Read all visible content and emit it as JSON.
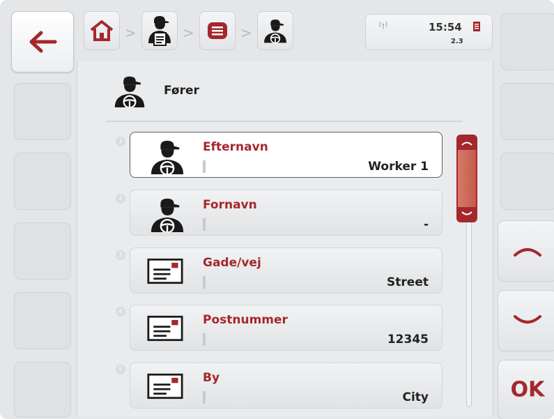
{
  "header": {
    "breadcrumbs": [
      {
        "icon": "home-icon"
      },
      {
        "icon": "driver-document-icon"
      },
      {
        "icon": "list-icon"
      },
      {
        "icon": "driver-icon"
      }
    ],
    "separator": ">"
  },
  "status": {
    "time": "15:54",
    "version": "2.3",
    "signal_icon": "signal-icon",
    "document_icon": "document-icon"
  },
  "left_nav": {
    "back_icon": "back-arrow-icon"
  },
  "right_nav": {
    "up_icon": "chevron-up-icon",
    "down_icon": "chevron-down-icon",
    "ok_label": "OK"
  },
  "page": {
    "title": "Fører",
    "title_icon": "driver-icon"
  },
  "items": [
    {
      "number": "1",
      "icon": "driver-icon",
      "label": "Efternavn",
      "value": "Worker 1",
      "selected": true
    },
    {
      "number": "2",
      "icon": "driver-icon",
      "label": "Fornavn",
      "value": "-",
      "selected": false
    },
    {
      "number": "3",
      "icon": "address-card-icon",
      "label": "Gade/vej",
      "value": "Street",
      "selected": false
    },
    {
      "number": "4",
      "icon": "address-card-icon",
      "label": "Postnummer",
      "value": "12345",
      "selected": false
    },
    {
      "number": "5",
      "icon": "address-card-icon",
      "label": "By",
      "value": "City",
      "selected": false
    }
  ],
  "colors": {
    "accent": "#a3282d",
    "scroll_thumb": "#cc6655"
  }
}
